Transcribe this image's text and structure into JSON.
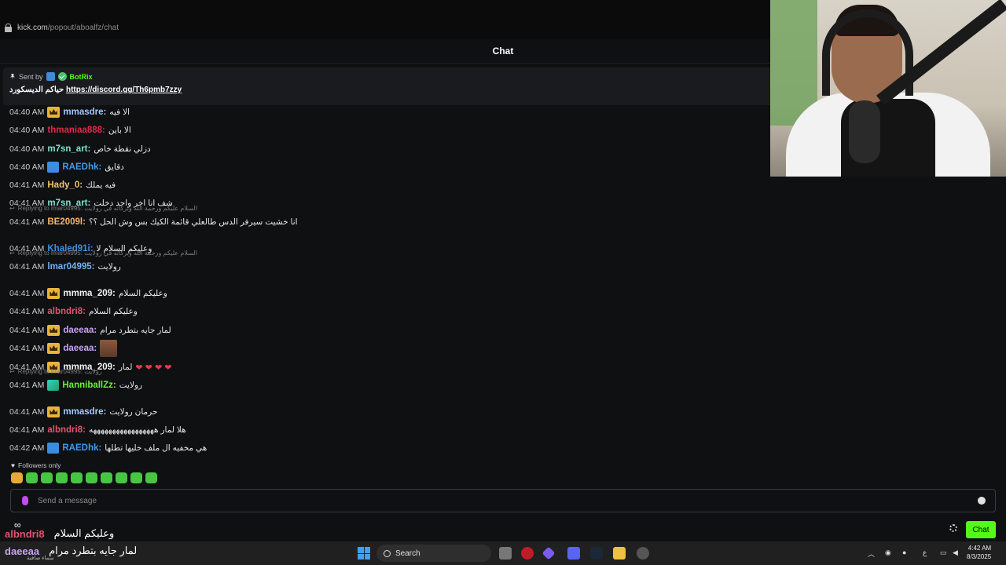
{
  "browser": {
    "url_domain": "kick.com",
    "url_path": "/popout/aboalfz/chat"
  },
  "chat": {
    "title": "Chat",
    "pinned": {
      "sent_by_label": "Sent by",
      "bot_name": "BotRix",
      "message_text": "حياكم الديسكورد",
      "link": "https://discord.gg/Th6pmb7zzy"
    },
    "messages": [
      {
        "time": "04:40 AM",
        "user": "mmasdre:",
        "color": "#a5c8ff",
        "badge": "crown",
        "text": "الا فيه"
      },
      {
        "time": "04:40 AM",
        "user": "thmaniaa888:",
        "color": "#e0294a",
        "badge": "",
        "text": "الا باين"
      },
      {
        "time": "04:40 AM",
        "user": "m7sn_art:",
        "color": "#7fe3d0",
        "badge": "",
        "text": "دزلي نقطة خاص"
      },
      {
        "time": "04:40 AM",
        "user": "RAEDhk:",
        "color": "#3f9cf0",
        "badge": "blue",
        "text": "دقايق"
      },
      {
        "time": "04:41 AM",
        "user": "Hady_0:",
        "color": "#f2c46d",
        "badge": "",
        "text": "فيه يملك"
      },
      {
        "time": "04:41 AM",
        "user": "m7sn_art:",
        "color": "#7fe3d0",
        "badge": "",
        "text": "شف انا اخر واحد دخلت"
      },
      {
        "time": "04:41 AM",
        "user": "BE2009l:",
        "color": "#f6b66a",
        "badge": "",
        "text": "انا خشيت سيرفر الدس طالعلي قائمة الكيك بس وش الحل ؟؟"
      },
      {
        "time": "04:41 AM",
        "user": "Khaled91i:",
        "color": "#3d8fe0",
        "badge": "",
        "text": "وعليكم السلام لا",
        "reply": "Replying to lmar04995: السلام عليكم ورحمة الله وبركاته في رولايت"
      },
      {
        "time": "04:41 AM",
        "user": "lmar04995:",
        "color": "#6fb2f5",
        "badge": "",
        "text": "رولايت"
      },
      {
        "time": "04:41 AM",
        "user": "mmma_209:",
        "color": "#f2f2f2",
        "badge": "crown",
        "text": "وعليكم السلام",
        "reply": "Replying to lmar04995: السلام عليكم ورحمة الله وبركاته في رولايت"
      },
      {
        "time": "04:41 AM",
        "user": "albndri8:",
        "color": "#e05570",
        "badge": "",
        "text": "وعليكم السلام"
      },
      {
        "time": "04:41 AM",
        "user": "daeeaa:",
        "color": "#c9a4f5",
        "badge": "crown",
        "text": "لمار جايه بتطرد مرام"
      },
      {
        "time": "04:41 AM",
        "user": "daeeaa:",
        "color": "#c9a4f5",
        "badge": "crown",
        "text": "",
        "emote": true
      },
      {
        "time": "04:41 AM",
        "user": "mmma_209:",
        "color": "#f2f2f2",
        "badge": "crown",
        "text": "لمار",
        "hearts": "❤ ❤ ❤ ❤"
      },
      {
        "time": "04:41 AM",
        "user": "HanniballZz:",
        "color": "#6df03a",
        "badge": "green",
        "text": "رولايت"
      },
      {
        "time": "04:41 AM",
        "user": "mmasdre:",
        "color": "#a5c8ff",
        "badge": "crown",
        "text": "حرمان رولايت",
        "reply": "Replying to lmar04995: رولايت"
      },
      {
        "time": "04:41 AM",
        "user": "albndri8:",
        "color": "#e05570",
        "badge": "",
        "text": "هلا لمار هههههههههههههههههه"
      },
      {
        "time": "04:42 AM",
        "user": "RAEDhk:",
        "color": "#3f9cf0",
        "badge": "blue",
        "text": "هي مخفيه ال ملف خليها تطلها"
      }
    ],
    "followers_only": "Followers only",
    "input_placeholder": "Send a message",
    "chat_button": "Chat"
  },
  "overlay": {
    "line1_user": "albndri8",
    "line1_text": "وعليكم السلام",
    "line2_user": "daeeaa",
    "line2_text": "لمار جايه بتطرد مرام",
    "line2_sub": "سماء صافية"
  },
  "taskbar": {
    "search_label": "Search",
    "time": "4:42 AM",
    "date": "8/3/2025",
    "lang": "ع"
  }
}
